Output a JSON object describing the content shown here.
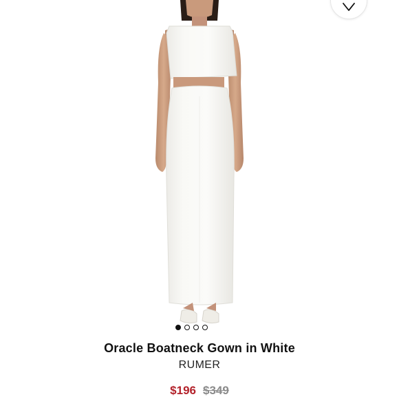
{
  "product": {
    "title": "Oracle Boatneck Gown in White",
    "brand": "RUMER",
    "sale_price": "$196",
    "original_price": "$349"
  },
  "carousel": {
    "total_images": 4,
    "active_index": 0
  },
  "icons": {
    "wishlist": "heart-icon"
  },
  "colors": {
    "sale_price": "#b3222b",
    "original_price": "#8a8a8a",
    "text": "#111111"
  }
}
